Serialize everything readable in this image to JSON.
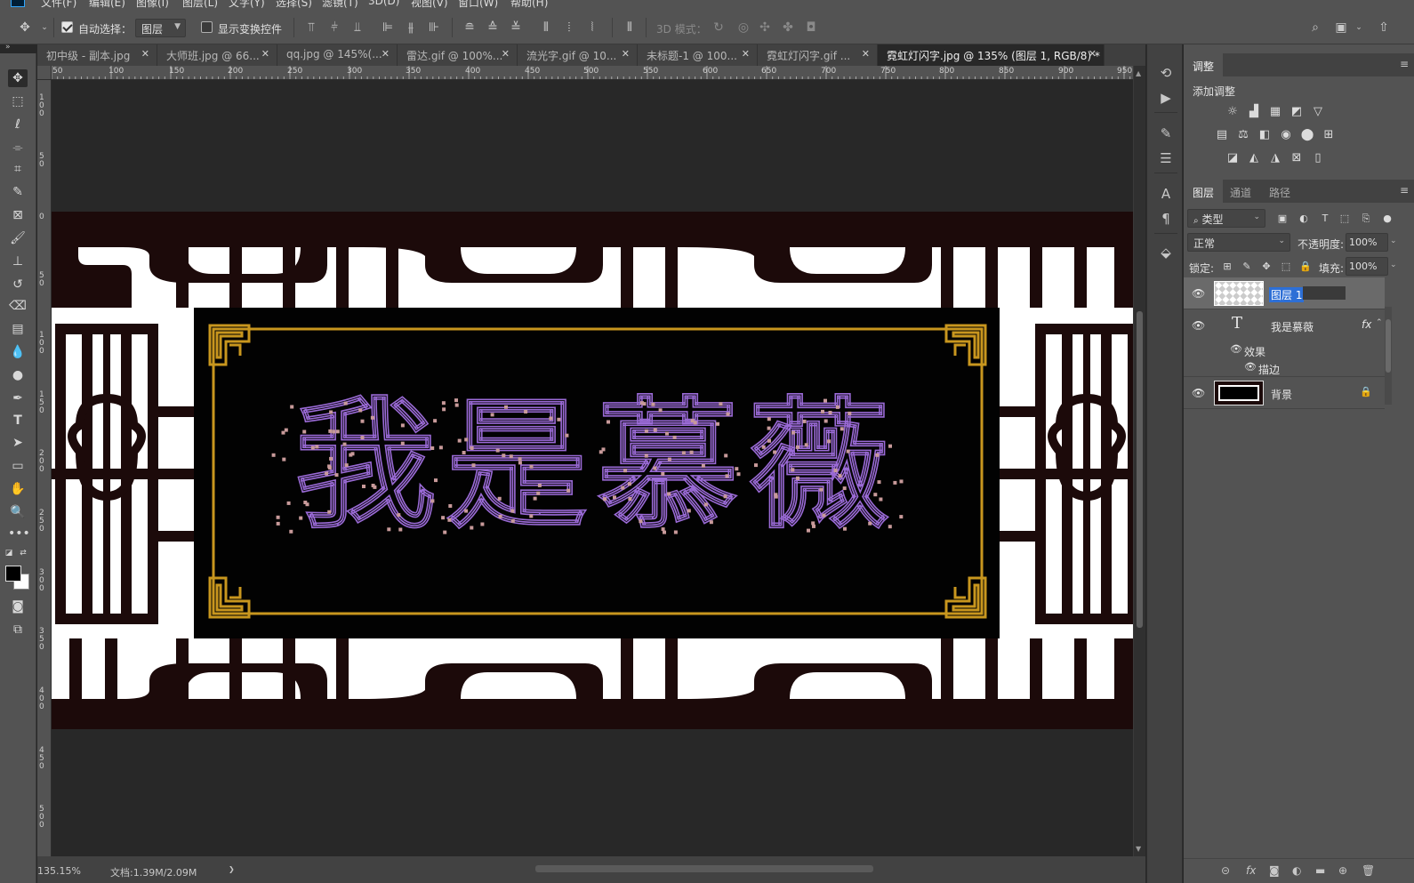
{
  "menubar": {
    "items": [
      "文件(F)",
      "编辑(E)",
      "图像(I)",
      "图层(L)",
      "文字(Y)",
      "选择(S)",
      "滤镜(T)",
      "3D(D)",
      "视图(V)",
      "窗口(W)",
      "帮助(H)"
    ]
  },
  "options_bar": {
    "auto_select_label": "自动选择：",
    "auto_select_checked": true,
    "auto_select_target": "图层",
    "show_transform_label": "显示变换控件",
    "show_transform_checked": false,
    "mode_3d_label": "3D 模式："
  },
  "tabs": [
    {
      "label": "初中级 - 副本.jpg",
      "active": false
    },
    {
      "label": "大师班.jpg @ 66...",
      "active": false
    },
    {
      "label": "qq.jpg @ 145%(...",
      "active": false
    },
    {
      "label": "雷达.gif @ 100%...",
      "active": false
    },
    {
      "label": "流光字.gif @ 10...",
      "active": false
    },
    {
      "label": "未标题-1 @ 100...",
      "active": false
    },
    {
      "label": "霓虹灯闪字.gif ...",
      "active": false
    },
    {
      "label": "霓虹灯闪字.jpg @ 135% (图层 1, RGB/8) *",
      "active": true
    }
  ],
  "rulers": {
    "horizontal": [
      "50",
      "100",
      "150",
      "200",
      "250",
      "300",
      "350",
      "400",
      "450",
      "500",
      "550",
      "600",
      "650",
      "700",
      "750",
      "800",
      "850",
      "900",
      "950"
    ],
    "vertical": [
      "100",
      "50",
      "0",
      "50",
      "100",
      "150",
      "200",
      "250",
      "300",
      "350",
      "400",
      "450",
      "500",
      "550",
      "600"
    ]
  },
  "canvas": {
    "artwork_text": "我是慕薇",
    "colors": {
      "frame_dark": "#1c0a0a",
      "lattice_white": "#ffffff",
      "panel_black": "#020202",
      "gold_border": "#c8961e",
      "path_outline": "#9a6ad6",
      "anchor_point": "#c89a9a"
    }
  },
  "status_bar": {
    "zoom": "135.15%",
    "doc_info": "文档:1.39M/2.09M"
  },
  "adjustments_panel": {
    "tab": "调整",
    "subtitle": "添加调整",
    "icons": [
      "brightness-icon",
      "levels-icon",
      "curves-icon",
      "exposure-icon",
      "vibrance-icon",
      "hue-saturation-icon",
      "color-balance-icon",
      "black-white-icon",
      "photo-filter-icon",
      "channel-mixer-icon",
      "color-lookup-icon",
      "invert-icon",
      "posterize-icon",
      "threshold-icon",
      "selective-color-icon",
      "gradient-map-icon"
    ]
  },
  "layers_panel": {
    "tabs": [
      "图层",
      "通道",
      "路径"
    ],
    "filter_label": "类型",
    "blend_mode": "正常",
    "opacity_label": "不透明度:",
    "opacity_value": "100%",
    "lock_label": "锁定:",
    "fill_label": "填充:",
    "fill_value": "100%",
    "layers": [
      {
        "name": "图层 1",
        "type": "pixel",
        "selected": true
      },
      {
        "name": "我是慕薇",
        "type": "text",
        "fx": "fx"
      },
      {
        "name": "效果",
        "type": "effects-group"
      },
      {
        "name": "描边",
        "type": "effect"
      },
      {
        "name": "背景",
        "type": "background",
        "locked": true
      }
    ]
  }
}
